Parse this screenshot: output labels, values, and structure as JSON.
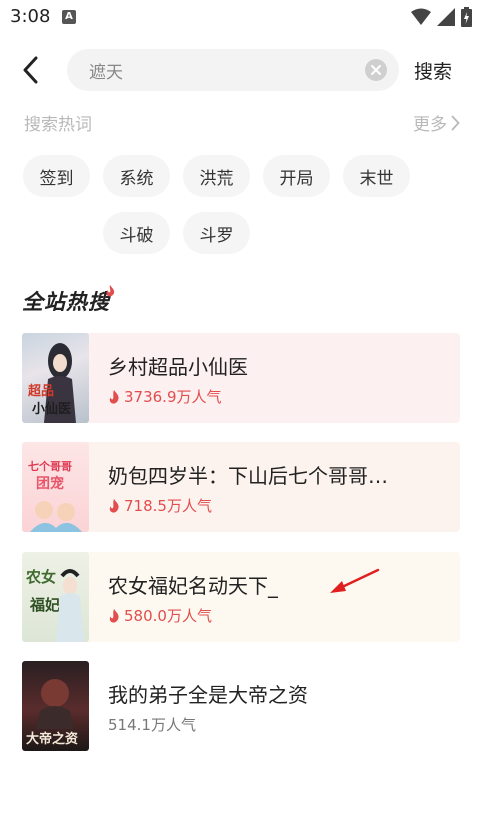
{
  "status_bar": {
    "time": "3:08",
    "notification_letter": "A",
    "icons": [
      "wifi-icon",
      "signal-icon",
      "battery-icon"
    ]
  },
  "search": {
    "back_icon": "chevron-left-icon",
    "query": "遮天",
    "clear_icon": "clear-icon",
    "submit_label": "搜索"
  },
  "hot_words": {
    "title": "搜索热词",
    "more_label": "更多",
    "tags": [
      "签到",
      "系统",
      "洪荒",
      "开局",
      "末世",
      "斗破",
      "斗罗"
    ]
  },
  "ranking": {
    "title": "全站热搜",
    "items": [
      {
        "title": "乡村超品小仙医",
        "popularity": "3736.9万人气",
        "hot": true,
        "cover_text": "超品\n小仙医"
      },
      {
        "title": "奶包四岁半：下山后七个哥哥…",
        "popularity": "718.5万人气",
        "hot": true,
        "cover_text": "七个哥哥\n团宠"
      },
      {
        "title": "农女福妃名动天下_",
        "popularity": "580.0万人气",
        "hot": true,
        "cover_text": "农女\n福妃"
      },
      {
        "title": "我的弟子全是大帝之资",
        "popularity": "514.1万人气",
        "hot": false,
        "cover_text": "大帝之资"
      }
    ]
  },
  "colors": {
    "accent_red": "#e24d4d",
    "card_bg_1": "#fdf0f0",
    "card_bg_2": "#fdf3ee",
    "card_bg_3": "#fdf9f1"
  }
}
